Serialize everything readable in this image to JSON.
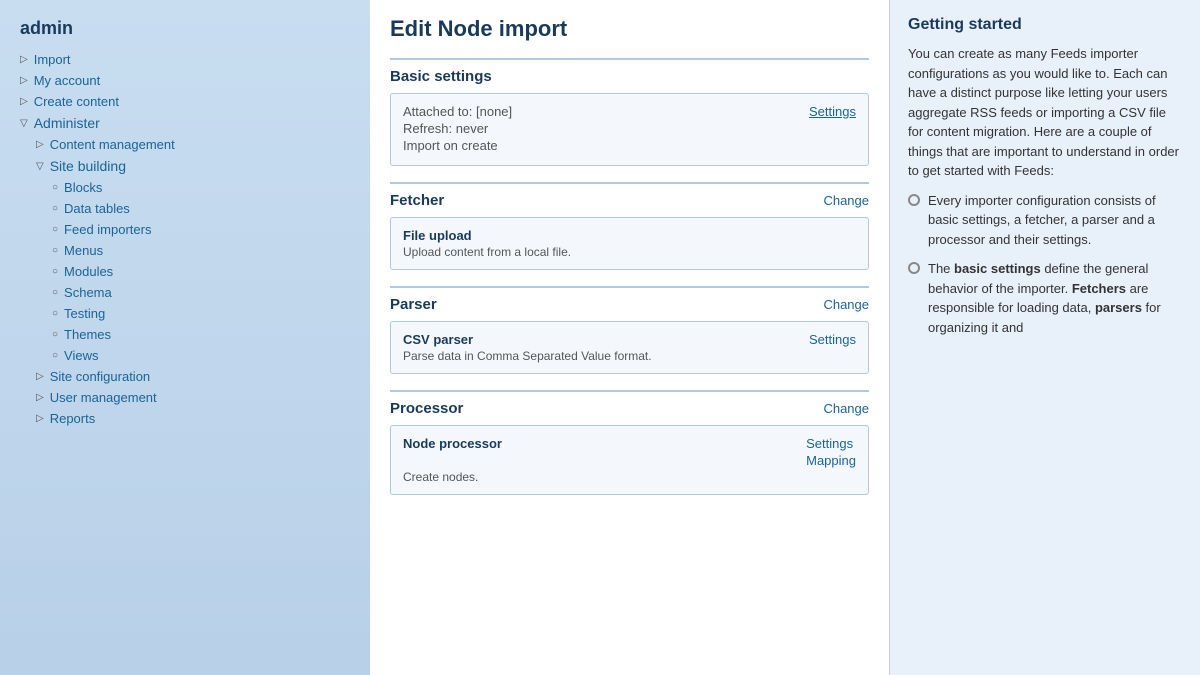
{
  "sidebar": {
    "title": "admin",
    "items": [
      {
        "id": "import",
        "label": "Import",
        "level": 1,
        "arrow": "▷",
        "indent": 1
      },
      {
        "id": "my-account",
        "label": "My account",
        "level": 1,
        "arrow": "▷",
        "indent": 1
      },
      {
        "id": "create-content",
        "label": "Create content",
        "level": 1,
        "arrow": "▷",
        "indent": 1
      },
      {
        "id": "administer",
        "label": "Administer",
        "level": 1,
        "arrow": "▽",
        "indent": 1
      },
      {
        "id": "content-management",
        "label": "Content management",
        "level": 2,
        "arrow": "▷",
        "indent": 2
      },
      {
        "id": "site-building",
        "label": "Site building",
        "level": 2,
        "arrow": "▽",
        "indent": 2
      },
      {
        "id": "blocks",
        "label": "Blocks",
        "level": 3,
        "arrow": "○",
        "indent": 3
      },
      {
        "id": "data-tables",
        "label": "Data tables",
        "level": 3,
        "arrow": "○",
        "indent": 3
      },
      {
        "id": "feed-importers",
        "label": "Feed importers",
        "level": 3,
        "arrow": "○",
        "indent": 3
      },
      {
        "id": "menus",
        "label": "Menus",
        "level": 3,
        "arrow": "○",
        "indent": 3
      },
      {
        "id": "modules",
        "label": "Modules",
        "level": 3,
        "arrow": "○",
        "indent": 3
      },
      {
        "id": "schema",
        "label": "Schema",
        "level": 3,
        "arrow": "○",
        "indent": 3
      },
      {
        "id": "testing",
        "label": "Testing",
        "level": 3,
        "arrow": "○",
        "indent": 3
      },
      {
        "id": "themes",
        "label": "Themes",
        "level": 3,
        "arrow": "○",
        "indent": 3
      },
      {
        "id": "views",
        "label": "Views",
        "level": 3,
        "arrow": "○",
        "indent": 3
      },
      {
        "id": "site-configuration",
        "label": "Site configuration",
        "level": 2,
        "arrow": "▷",
        "indent": 2
      },
      {
        "id": "user-management",
        "label": "User management",
        "level": 2,
        "arrow": "▷",
        "indent": 2
      },
      {
        "id": "reports",
        "label": "Reports",
        "level": 2,
        "arrow": "▷",
        "indent": 2
      }
    ]
  },
  "page": {
    "title": "Edit Node import",
    "sections": {
      "basic_settings": {
        "heading": "Basic settings",
        "attached_to": "Attached to: [none]",
        "refresh": "Refresh: never",
        "import_on_create": "Import on create",
        "settings_link": "Settings"
      },
      "fetcher": {
        "heading": "Fetcher",
        "change_link": "Change",
        "name": "File upload",
        "description": "Upload content from a local file."
      },
      "parser": {
        "heading": "Parser",
        "change_link": "Change",
        "name": "CSV parser",
        "settings_link": "Settings",
        "description": "Parse data in Comma Separated Value format."
      },
      "processor": {
        "heading": "Processor",
        "change_link": "Change",
        "name": "Node processor",
        "settings_link": "Settings",
        "mapping_link": "Mapping",
        "description": "Create nodes."
      }
    }
  },
  "right_panel": {
    "title": "Getting started",
    "intro": "You can create as many Feeds importer configurations as you would like to. Each can have a distinct purpose like letting your users aggregate RSS feeds or importing a CSV file for content migration. Here are a couple of things that are important to understand in order to get started with Feeds:",
    "list_items": [
      "Every importer configuration consists of basic settings, a fetcher, a parser and a processor and their settings.",
      "The basic settings define the general behavior of the importer. Fetchers are responsible for loading data, parsers for organizing it and"
    ]
  }
}
